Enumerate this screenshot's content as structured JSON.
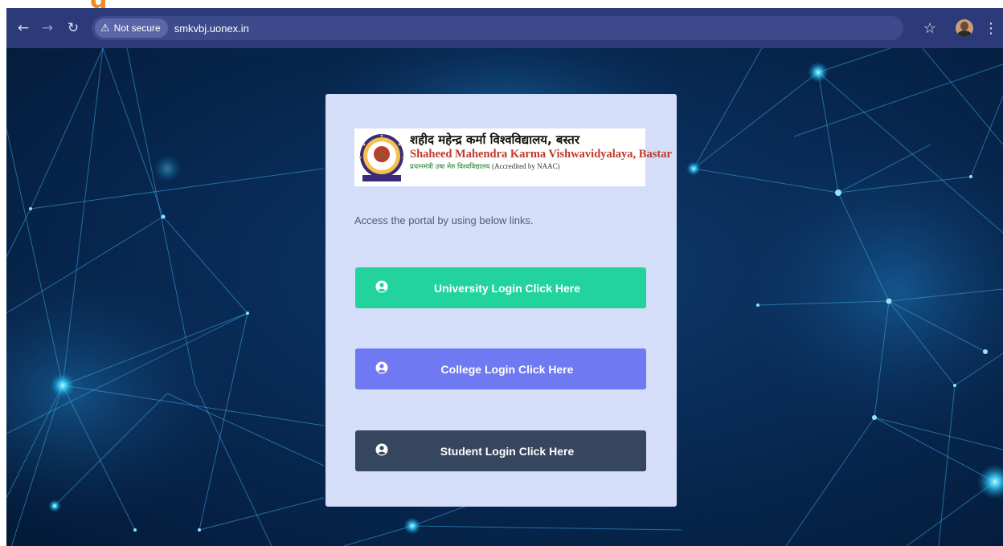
{
  "page_fragment": "g",
  "browser": {
    "security_label": "Not secure",
    "url": "smkvbj.uonex.in",
    "icons": [
      "back-arrow-icon",
      "forward-arrow-icon",
      "reload-icon",
      "warning-icon",
      "star-icon",
      "profile-avatar-icon",
      "kebab-menu-icon"
    ]
  },
  "logo": {
    "hindi_name": "शहीद महेन्द्र कर्मा विश्वविद्यालय, बस्तर",
    "english_name": "Shaheed Mahendra Karma Vishwavidyalaya, Bastar",
    "sub_hindi": "प्रधानमंत्री उषा मेरु विश्वविद्यालय",
    "accreditation": "(Accredited by NAAC)"
  },
  "intro": "Access the portal by using below links.",
  "buttons": {
    "university": "University Login Click Here",
    "college": "College Login Click Here",
    "student": "Student Login Click Here"
  },
  "colors": {
    "toolbar": "#2d3a7a",
    "card": "#d4def8",
    "university_button": "#22d39e",
    "college_button": "#6f79f2",
    "student_button": "#36465e",
    "accent_fragment": "#f08a24"
  }
}
